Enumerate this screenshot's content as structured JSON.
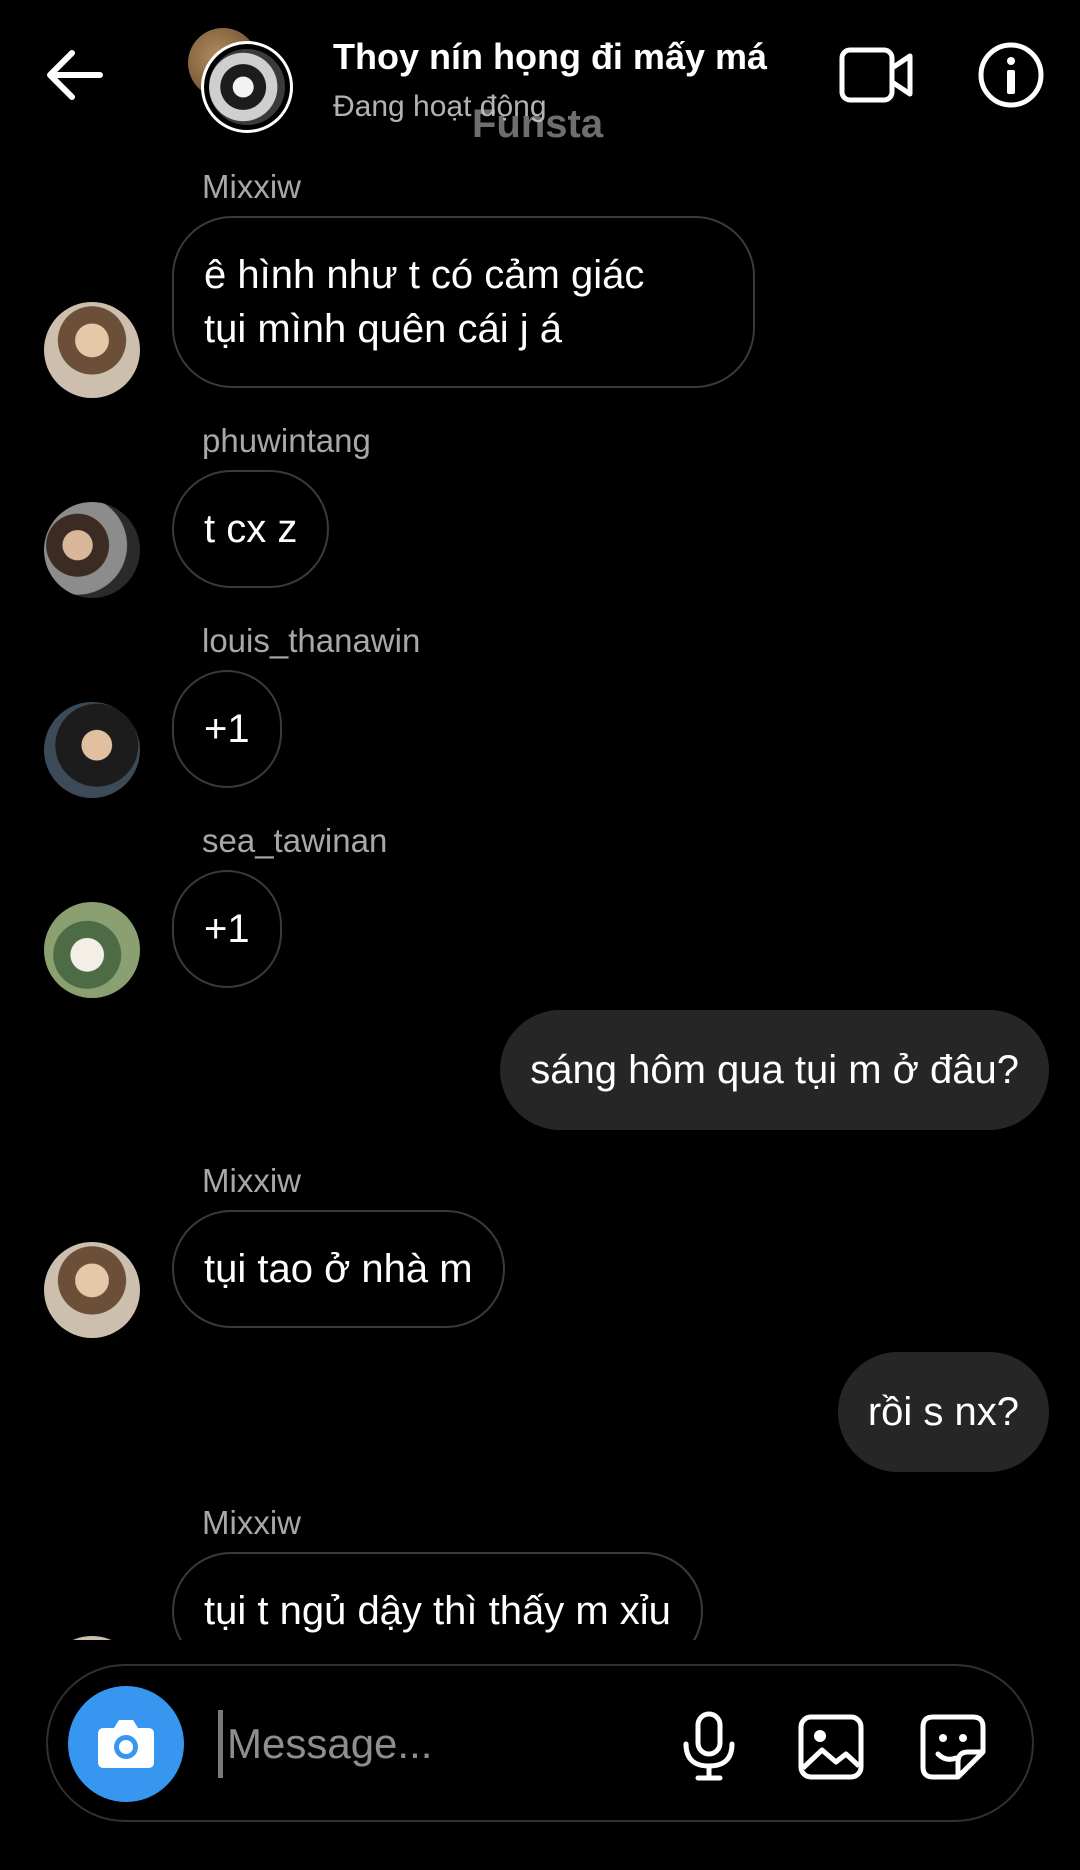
{
  "header": {
    "title": "Thoy nín họng đi mấy má",
    "status": "Đang hoạt động",
    "watermark": "Funsta",
    "icons": {
      "back": "arrow-left-icon",
      "video": "video-camera-icon",
      "info": "info-icon"
    }
  },
  "messages": [
    {
      "direction": "in",
      "sender": "Mixxiw",
      "text_lines": [
        "ê hình như t có cảm giác",
        "tụi mình quên cái j á"
      ]
    },
    {
      "direction": "in",
      "sender": "phuwintang",
      "text": "t cx z"
    },
    {
      "direction": "in",
      "sender": "louis_thanawin",
      "text": "+1"
    },
    {
      "direction": "in",
      "sender": "sea_tawinan",
      "text": "+1"
    },
    {
      "direction": "out",
      "text": "sáng hôm qua tụi m ở đâu?"
    },
    {
      "direction": "in",
      "sender": "Mixxiw",
      "text": "tụi tao ở nhà m"
    },
    {
      "direction": "out",
      "text": "rồi s nx?"
    },
    {
      "direction": "in",
      "sender": "Mixxiw",
      "text": "tụi t ngủ dậy thì thấy m xỉu"
    }
  ],
  "composer": {
    "placeholder": "Message...",
    "icons": {
      "camera": "camera-icon",
      "mic": "microphone-icon",
      "gallery": "image-icon",
      "sticker": "sticker-icon"
    }
  },
  "colors": {
    "background": "#000000",
    "outgoing_bubble": "#262626",
    "incoming_border": "#3a3a3a",
    "camera_button": "#3797f0",
    "secondary_text": "#a8a8a8"
  }
}
